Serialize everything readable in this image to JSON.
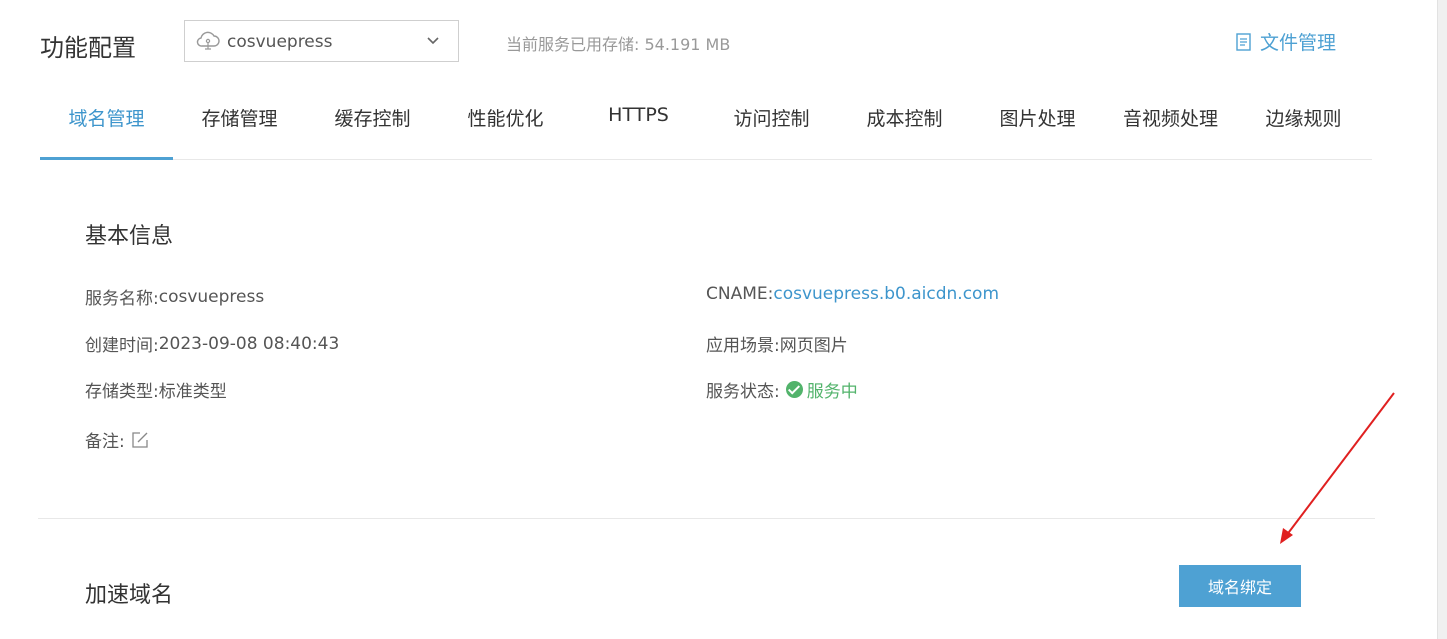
{
  "header": {
    "title": "功能配置",
    "service_select": {
      "value": "cosvuepress"
    },
    "storage_text": "当前服务已用存储: 54.191 MB",
    "file_mgmt_label": "文件管理"
  },
  "tabs": [
    {
      "label": "域名管理",
      "active": true
    },
    {
      "label": "存储管理"
    },
    {
      "label": "缓存控制"
    },
    {
      "label": "性能优化"
    },
    {
      "label": "HTTPS"
    },
    {
      "label": "访问控制"
    },
    {
      "label": "成本控制"
    },
    {
      "label": "图片处理"
    },
    {
      "label": "音视频处理"
    },
    {
      "label": "边缘规则"
    }
  ],
  "basic_info": {
    "title": "基本信息",
    "service_name_label": "服务名称:",
    "service_name": "cosvuepress",
    "created_label": "创建时间:",
    "created": "2023-09-08 08:40:43",
    "storage_type_label": "存储类型:",
    "storage_type": "标准类型",
    "remark_label": "备注:",
    "cname_label": "CNAME:",
    "cname": "cosvuepress.b0.aicdn.com",
    "scenario_label": "应用场景:",
    "scenario": "网页图片",
    "status_label": "服务状态:",
    "status": "服务中"
  },
  "accel_domain": {
    "title": "加速域名",
    "bind_button": "域名绑定"
  },
  "colors": {
    "accent": "#4ea1d3",
    "link": "#3d95cc",
    "success": "#52b36b",
    "annotation_arrow": "#e02020"
  }
}
